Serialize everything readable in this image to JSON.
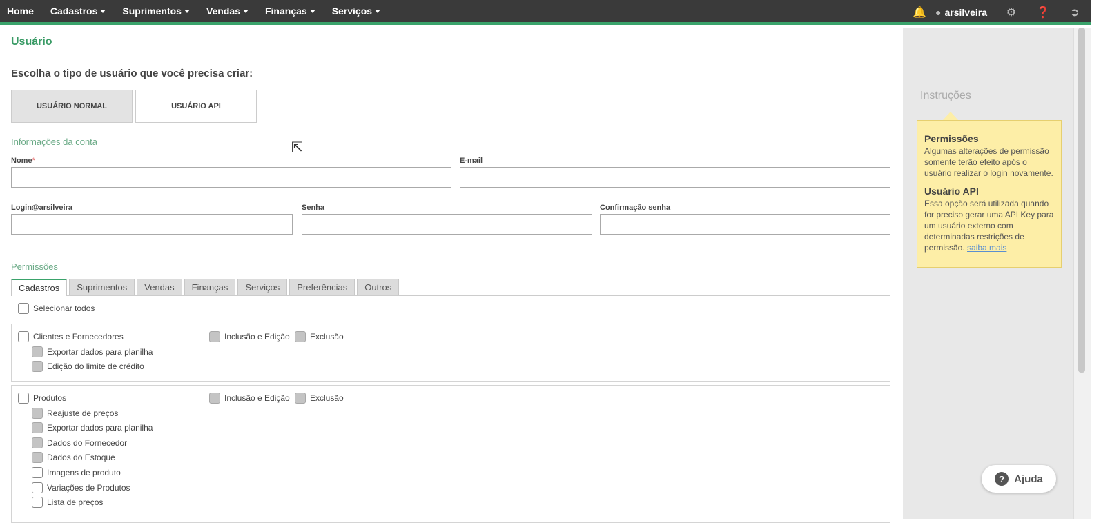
{
  "nav": {
    "items": [
      "Home",
      "Cadastros",
      "Suprimentos",
      "Vendas",
      "Finanças",
      "Serviços"
    ],
    "user": "arsilveira"
  },
  "page": {
    "title": "Usuário",
    "choose_label": "Escolha o tipo de usuário que você precisa criar:",
    "type_normal": "USUÁRIO NORMAL",
    "type_api": "USUÁRIO API"
  },
  "account": {
    "section": "Informações da conta",
    "nome_label": "Nome",
    "email_label": "E-mail",
    "login_label": "Login@arsilveira",
    "senha_label": "Senha",
    "confirm_label": "Confirmação senha"
  },
  "permissions": {
    "section": "Permissões",
    "tabs": [
      "Cadastros",
      "Suprimentos",
      "Vendas",
      "Finanças",
      "Serviços",
      "Preferências",
      "Outros"
    ],
    "select_all": "Selecionar todos",
    "inclusao": "Inclusão e Edição",
    "exclusao": "Exclusão",
    "group1": {
      "label": "Clientes e Fornecedores",
      "subs": [
        "Exportar dados para planilha",
        "Edição do limite de crédito"
      ]
    },
    "group2": {
      "label": "Produtos",
      "subs": [
        "Reajuste de preços",
        "Exportar dados para planilha",
        "Dados do Fornecedor",
        "Dados do Estoque",
        "Imagens de produto",
        "Variações de Produtos",
        "Lista de preços"
      ]
    }
  },
  "instructions": {
    "title": "Instruções",
    "h1": "Permissões",
    "p1": "Algumas alterações de permissão somente terão efeito após o usuário realizar o login novamente.",
    "h2": "Usuário API",
    "p2": "Essa opção será utilizada quando for preciso gerar uma API Key para um usuário externo com determinadas restrições de permissão.",
    "link": "saiba mais"
  },
  "help": {
    "label": "Ajuda"
  }
}
